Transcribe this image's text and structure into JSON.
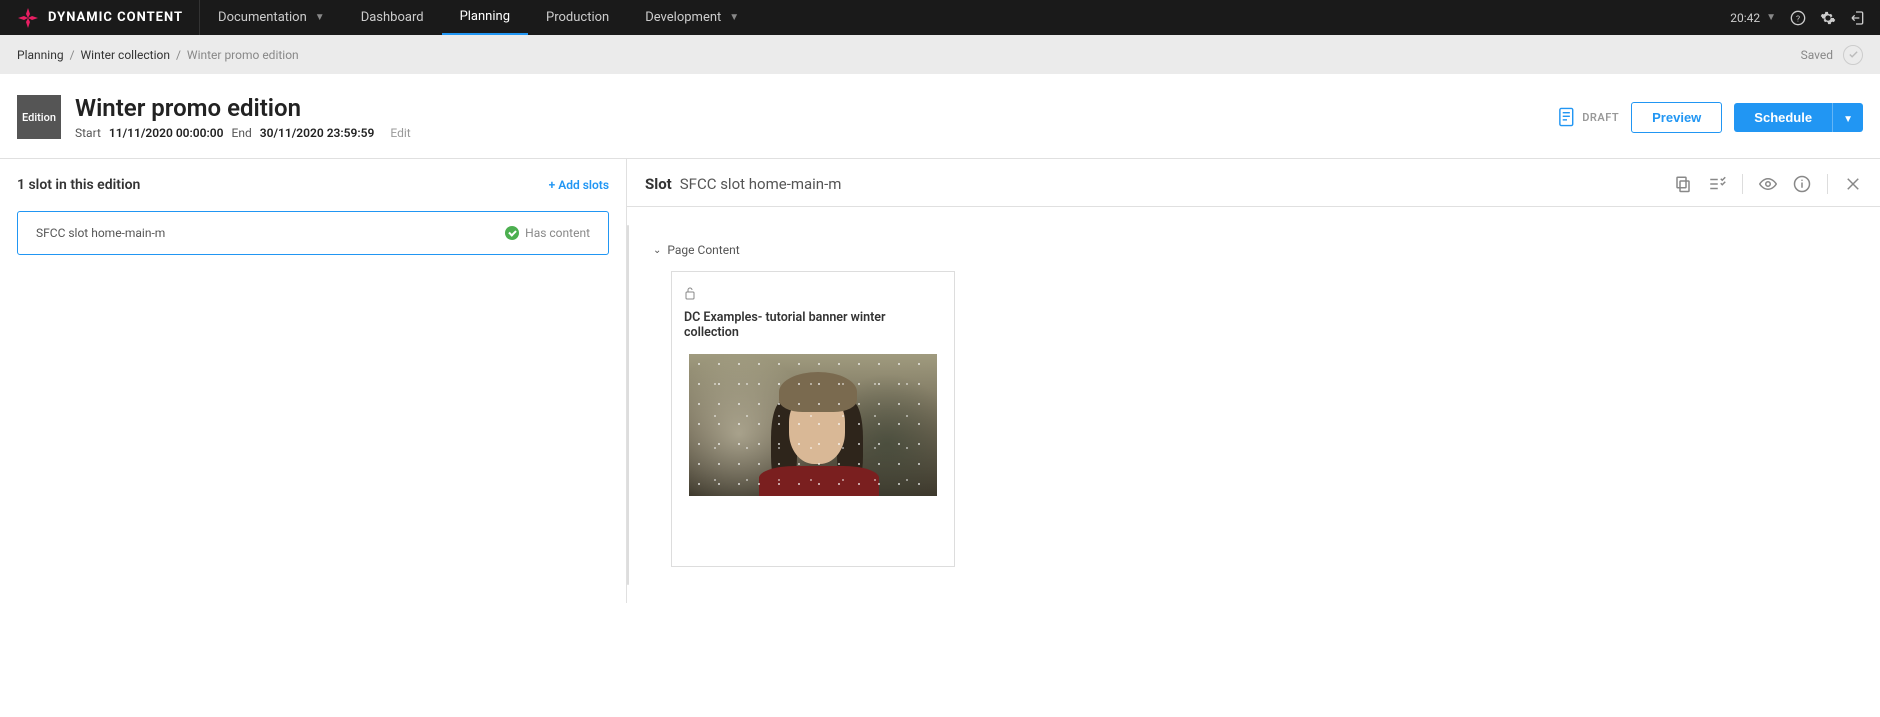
{
  "brand": "DYNAMIC CONTENT",
  "nav": {
    "documentation": "Documentation",
    "dashboard": "Dashboard",
    "planning": "Planning",
    "production": "Production",
    "development": "Development"
  },
  "time": "20:42",
  "breadcrumb": {
    "planning": "Planning",
    "collection": "Winter collection",
    "current": "Winter promo edition",
    "saved": "Saved"
  },
  "edition": {
    "badge": "Edition",
    "title": "Winter promo edition",
    "start_label": "Start",
    "start_value": "11/11/2020 00:00:00",
    "end_label": "End",
    "end_value": "30/11/2020 23:59:59",
    "edit": "Edit",
    "status": "DRAFT",
    "preview": "Preview",
    "schedule": "Schedule"
  },
  "slots": {
    "count_label": "1 slot in this edition",
    "add_label": "+ Add slots",
    "items": [
      {
        "name": "SFCC slot home-main-m",
        "status": "Has content"
      }
    ]
  },
  "slot_panel": {
    "title": "Slot",
    "name": "SFCC slot home-main-m",
    "section_label": "Page Content",
    "content_title": "DC Examples- tutorial banner winter collection"
  }
}
